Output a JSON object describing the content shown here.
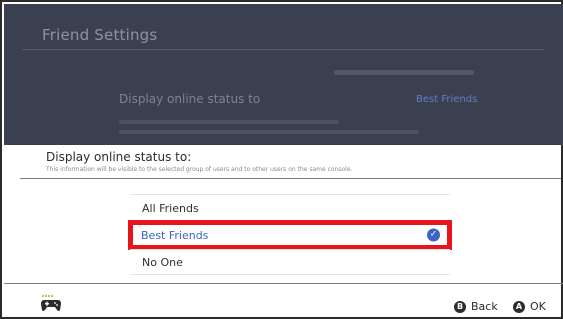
{
  "background_screen": {
    "title": "Friend Settings",
    "row_label": "Display online status to",
    "row_value": "Best Friends"
  },
  "dialog": {
    "title": "Display online status to:",
    "subtitle": "This information will be visible to the selected group of users and to other users on the same console.",
    "options": [
      {
        "label": "All Friends",
        "selected": false
      },
      {
        "label": "Best Friends",
        "selected": true
      },
      {
        "label": "No One",
        "selected": false
      }
    ],
    "highlight_color": "#e8141c",
    "accent_color": "#3d63c7"
  },
  "footer": {
    "controller_icon": "controller-icon",
    "back": {
      "glyph": "B",
      "label": "Back"
    },
    "ok": {
      "glyph": "A",
      "label": "OK"
    }
  }
}
